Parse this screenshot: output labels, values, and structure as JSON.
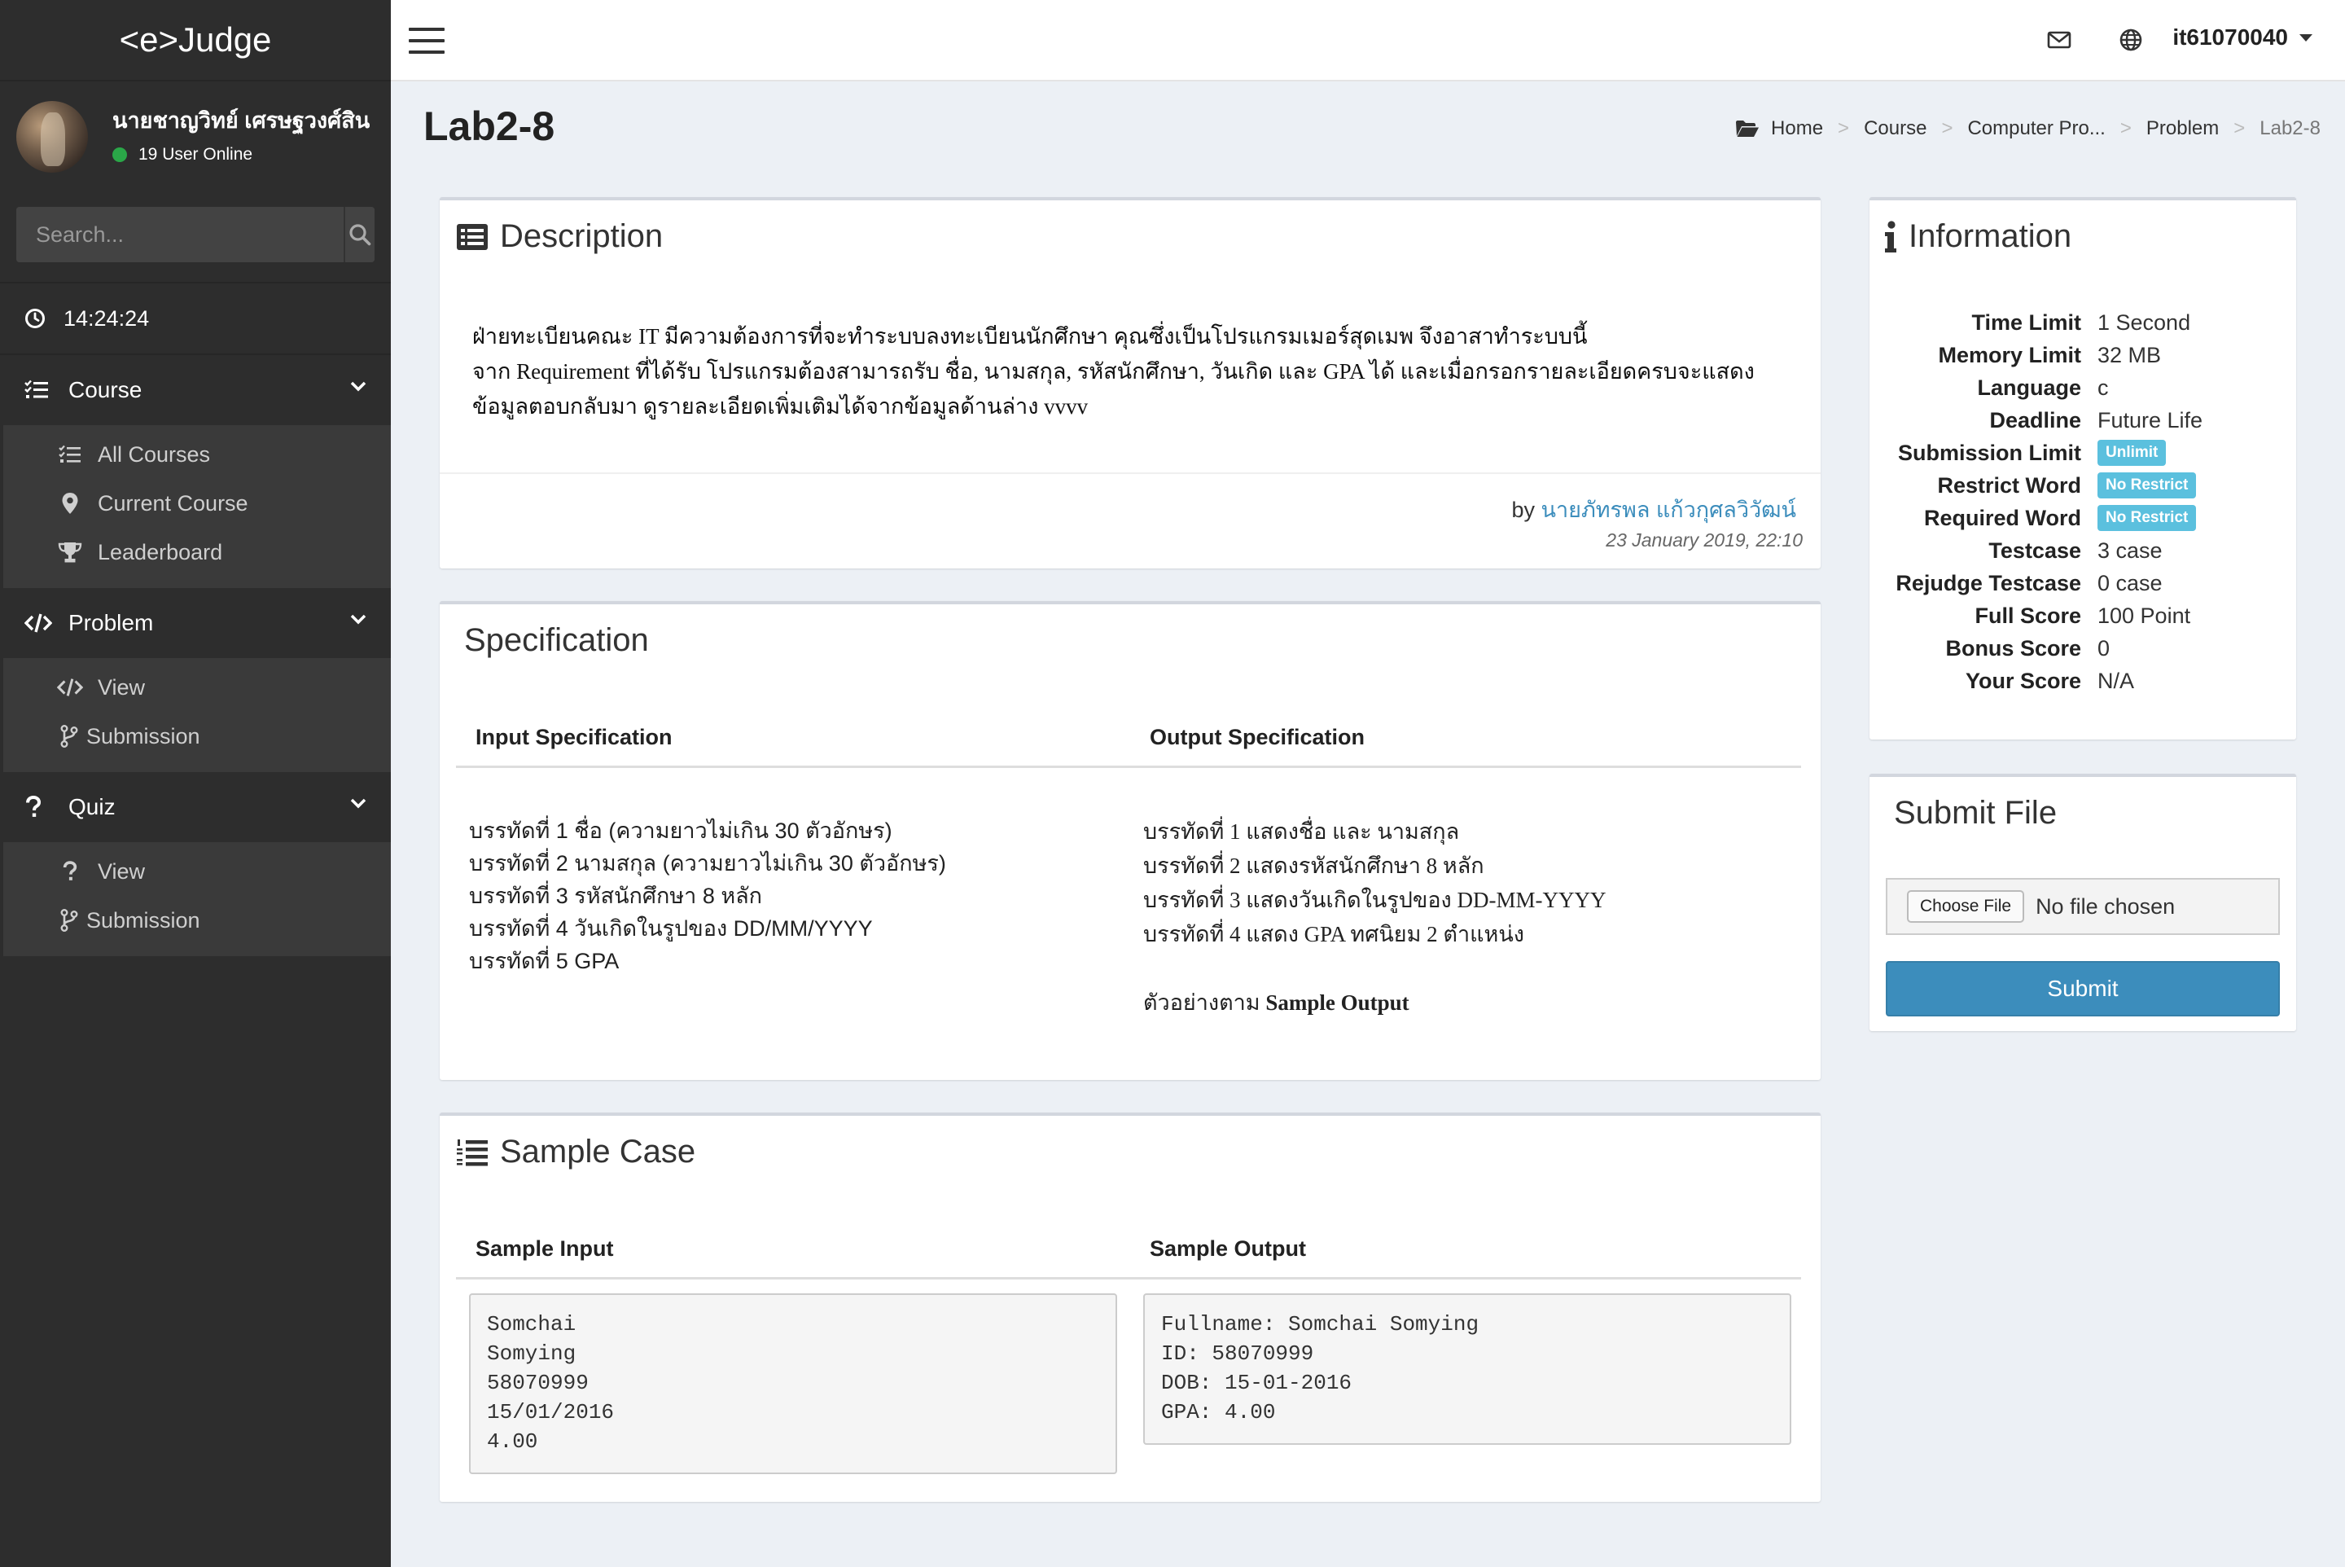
{
  "sidebar": {
    "logo": "<e>Judge",
    "user_name": "นายชาญวิทย์ เศรษฐวงศ์สิน",
    "online_text": "19 User Online",
    "search_placeholder": "Search...",
    "clock": "14:24:24",
    "course": {
      "label": "Course",
      "items": [
        "All Courses",
        "Current Course",
        "Leaderboard"
      ]
    },
    "problem": {
      "label": "Problem",
      "items": [
        "View",
        "Submission"
      ]
    },
    "quiz": {
      "label": "Quiz",
      "items": [
        "View",
        "Submission"
      ]
    }
  },
  "topbar": {
    "username": "it61070040"
  },
  "page": {
    "title": "Lab2-8",
    "breadcrumb": [
      "Home",
      "Course",
      "Computer Pro...",
      "Problem",
      "Lab2-8"
    ]
  },
  "description": {
    "title": "Description",
    "lines": [
      "ฝ่ายทะเบียนคณะ IT มีความต้องการที่จะทำระบบลงทะเบียนนักศึกษา คุณซึ่งเป็นโปรแกรมเมอร์สุดเมพ จึงอาสาทำระบบนี้",
      "จาก Requirement ที่ได้รับ โปรแกรมต้องสามารถรับ ชื่อ, นามสกุล, รหัสนักศึกษา, วันเกิด และ GPA ได้ และเมื่อกรอกรายละเอียดครบจะแสดง",
      "ข้อมูลตอบกลับมา ดูรายละเอียดเพิ่มเติมได้จากข้อมูลด้านล่าง vvvv"
    ],
    "by_prefix": "by",
    "author": "นายภัทรพล แก้วกุศลวิวัฒน์",
    "date": "23 January 2019, 22:10"
  },
  "specification": {
    "title": "Specification",
    "input_head": "Input Specification",
    "output_head": "Output Specification",
    "input_lines": [
      "บรรทัดที่ 1 ชื่อ (ความยาวไม่เกิน 30 ตัวอักษร)",
      "บรรทัดที่ 2 นามสกุล (ความยาวไม่เกิน 30 ตัวอักษร)",
      "บรรทัดที่ 3 รหัสนักศึกษา 8 หลัก",
      "บรรทัดที่ 4 วันเกิดในรูปของ DD/MM/YYYY",
      "บรรทัดที่ 5 GPA"
    ],
    "output_lines": [
      "บรรทัดที่ 1 แสดงชื่อ และ นามสกุล",
      "บรรทัดที่ 2 แสดงรหัสนักศึกษา 8 หลัก",
      "บรรทัดที่ 3 แสดงวันเกิดในรูปของ DD-MM-YYYY",
      "บรรทัดที่ 4 แสดง GPA ทศนิยม 2 ตำแหน่ง"
    ],
    "output_note_prefix": "ตัวอย่างตาม ",
    "output_note_bold": "Sample Output"
  },
  "sample": {
    "title": "Sample Case",
    "input_head": "Sample Input",
    "output_head": "Sample Output",
    "input_text": "Somchai\nSomying\n58070999\n15/01/2016\n4.00",
    "output_text": "Fullname: Somchai Somying\nID: 58070999\nDOB: 15-01-2016\nGPA: 4.00"
  },
  "information": {
    "title": "Information",
    "rows": [
      {
        "key": "Time Limit",
        "value": "1 Second"
      },
      {
        "key": "Memory Limit",
        "value": "32 MB"
      },
      {
        "key": "Language",
        "value": "c"
      },
      {
        "key": "Deadline",
        "value": "Future Life"
      },
      {
        "key": "Submission Limit",
        "value": "Unlimit"
      },
      {
        "key": "Restrict Word",
        "value": "No Restrict"
      },
      {
        "key": "Required Word",
        "value": "No Restrict"
      },
      {
        "key": "Testcase",
        "value": "3 case"
      },
      {
        "key": "Rejudge Testcase",
        "value": "0 case"
      },
      {
        "key": "Full Score",
        "value": "100 Point"
      },
      {
        "key": "Bonus Score",
        "value": "0"
      },
      {
        "key": "Your Score",
        "value": "N/A"
      }
    ]
  },
  "submit": {
    "title": "Submit File",
    "choose_label": "Choose File",
    "no_file": "No file chosen",
    "button": "Submit"
  },
  "colors": {
    "sidebar_bg": "#2d2d2d",
    "accent": "#3c8dbc",
    "badge": "#5bc0de",
    "online": "#2aa748"
  }
}
